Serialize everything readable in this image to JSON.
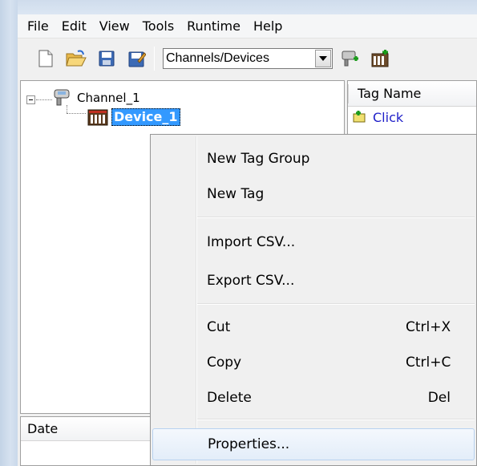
{
  "menu": {
    "items": [
      "File",
      "Edit",
      "View",
      "Tools",
      "Runtime",
      "Help"
    ]
  },
  "toolbar": {
    "view_select_value": "Channels/Devices",
    "icons": [
      "new-file-icon",
      "open-folder-icon",
      "save-icon",
      "save-as-icon",
      "new-channel-icon",
      "new-device-icon"
    ]
  },
  "tree": {
    "channel_label": "Channel_1",
    "device_label": "Device_1"
  },
  "tags": {
    "column_header": "Tag Name",
    "first_tag": "Click"
  },
  "events": {
    "date_header": "Date"
  },
  "context_menu": {
    "new_tag_group": "New Tag Group",
    "new_tag": "New Tag",
    "import_csv": "Import CSV...",
    "export_csv": "Export CSV...",
    "cut": "Cut",
    "cut_shortcut": "Ctrl+X",
    "copy": "Copy",
    "copy_shortcut": "Ctrl+C",
    "delete": "Delete",
    "delete_shortcut": "Del",
    "properties": "Properties..."
  },
  "colors": {
    "selection": "#3399ff",
    "tag_link": "#1e1ec8",
    "menu_hover_border": "#b8d2f0"
  }
}
